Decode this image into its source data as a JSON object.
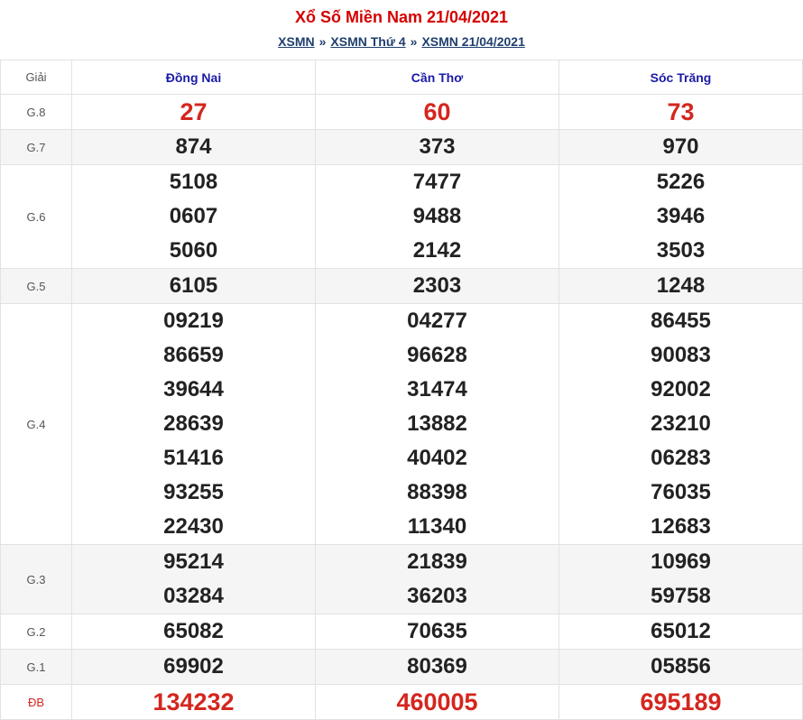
{
  "header": {
    "title": "Xổ Số Miền Nam 21/04/2021",
    "crumbs": [
      "XSMN",
      "XSMN Thứ 4",
      "XSMN 21/04/2021"
    ],
    "separator": "»"
  },
  "table": {
    "label_header": "Giải",
    "provinces": [
      "Đồng Nai",
      "Cần Thơ",
      "Sóc Trăng"
    ],
    "rows": [
      {
        "label": "G.8",
        "values": [
          [
            "27"
          ],
          [
            "60"
          ],
          [
            "73"
          ]
        ]
      },
      {
        "label": "G.7",
        "values": [
          [
            "874"
          ],
          [
            "373"
          ],
          [
            "970"
          ]
        ]
      },
      {
        "label": "G.6",
        "values": [
          [
            "5108",
            "0607",
            "5060"
          ],
          [
            "7477",
            "9488",
            "2142"
          ],
          [
            "5226",
            "3946",
            "3503"
          ]
        ]
      },
      {
        "label": "G.5",
        "values": [
          [
            "6105"
          ],
          [
            "2303"
          ],
          [
            "1248"
          ]
        ]
      },
      {
        "label": "G.4",
        "values": [
          [
            "09219",
            "86659",
            "39644",
            "28639",
            "51416",
            "93255",
            "22430"
          ],
          [
            "04277",
            "96628",
            "31474",
            "13882",
            "40402",
            "88398",
            "11340"
          ],
          [
            "86455",
            "90083",
            "92002",
            "23210",
            "06283",
            "76035",
            "12683"
          ]
        ]
      },
      {
        "label": "G.3",
        "values": [
          [
            "95214",
            "03284"
          ],
          [
            "21839",
            "36203"
          ],
          [
            "10969",
            "59758"
          ]
        ]
      },
      {
        "label": "G.2",
        "values": [
          [
            "65082"
          ],
          [
            "70635"
          ],
          [
            "65012"
          ]
        ]
      },
      {
        "label": "G.1",
        "values": [
          [
            "69902"
          ],
          [
            "80369"
          ],
          [
            "05856"
          ]
        ]
      },
      {
        "label": "ĐB",
        "values": [
          [
            "134232"
          ],
          [
            "460005"
          ],
          [
            "695189"
          ]
        ]
      }
    ]
  },
  "colors": {
    "title": "#d40000",
    "special": "#d4261e",
    "province": "#1a1aa8",
    "link": "#1f3f6e"
  }
}
